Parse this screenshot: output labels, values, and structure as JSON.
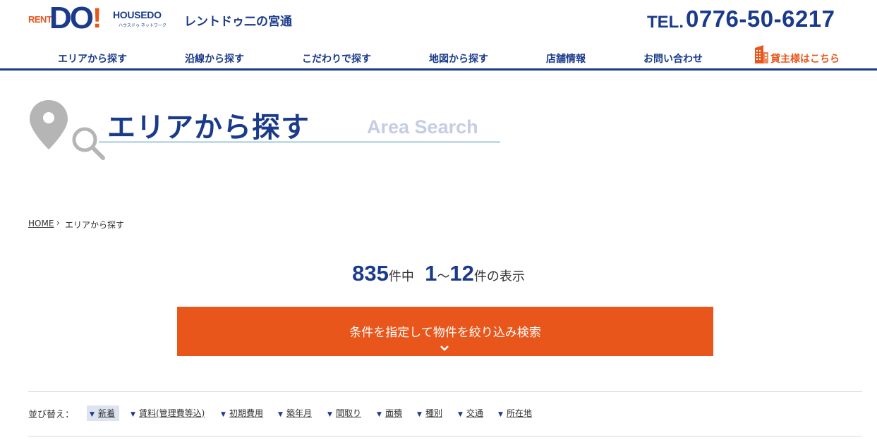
{
  "header": {
    "logo_rent": "RENT",
    "logo_do": "DO",
    "logo_bang": "!",
    "logo_housedo": "HOUSEDO",
    "logo_housedo_sub": "ハウスドゥ ネットワーク",
    "store_name": "レントドゥ二の宮通",
    "tel_label": "TEL.",
    "tel_number": "0776-50-6217",
    "brand_color": "#1a3a8a",
    "accent_color": "#e8561b"
  },
  "nav": {
    "items": [
      {
        "label": "エリアから探す"
      },
      {
        "label": "沿線から探す"
      },
      {
        "label": "こだわりで探す"
      },
      {
        "label": "地図から探す"
      },
      {
        "label": "店舗情報"
      },
      {
        "label": "お問い合わせ"
      },
      {
        "label": "貸主様はこちら",
        "icon": "building-icon"
      }
    ]
  },
  "hero": {
    "title": "エリアから探す",
    "subtitle": "Area Search",
    "icons": [
      "map-pin-icon",
      "magnifier-icon"
    ]
  },
  "breadcrumb": {
    "home": "HOME",
    "separator": "›",
    "current": "エリアから探す"
  },
  "results": {
    "total": "835",
    "total_suffix": "件中",
    "range_start": "1",
    "range_sep": "～",
    "range_end": "12",
    "range_suffix": "件の表示"
  },
  "search_button": {
    "label": "条件を指定して物件を絞り込み検索",
    "icon": "chevron-down-icon"
  },
  "sort": {
    "label": "並び替え：",
    "active_index": 0,
    "options": [
      {
        "label": "新着"
      },
      {
        "label": "賃料(管理費等込)"
      },
      {
        "label": "初期費用"
      },
      {
        "label": "築年月"
      },
      {
        "label": "間取り"
      },
      {
        "label": "面積"
      },
      {
        "label": "種別"
      },
      {
        "label": "交通"
      },
      {
        "label": "所在地"
      }
    ]
  }
}
